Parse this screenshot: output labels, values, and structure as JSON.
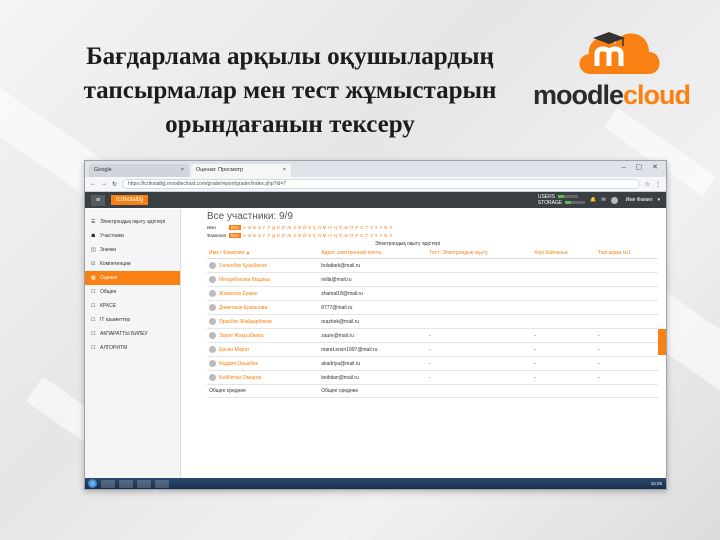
{
  "slide": {
    "title_lines": [
      "Бағдарлама арқылы оқушылардың",
      "тапсырмалар мен тест жұмыстарын",
      "орындағанын тексеру"
    ],
    "logo": {
      "part1": "moodle",
      "part2": "cloud"
    }
  },
  "colors": {
    "accent": "#f98012",
    "navbar": "#3a3f44"
  },
  "browser": {
    "tabs": [
      {
        "label": "Google",
        "close": "×"
      },
      {
        "label": "Оценки: Просмотр",
        "close": "×"
      }
    ],
    "window_controls": "– ▢ ✕",
    "url": "https://tcrtkotalbjj.moodlecloud.com/grade/report/grader/index.php?id=7"
  },
  "moodle": {
    "brand": "tcrtkotalbjj",
    "menu_icon": "≡",
    "users_label": "USERS",
    "storage_label": "STORAGE",
    "user_name": "Имя Фамил",
    "drawer": [
      {
        "icon": "☰",
        "label": "Электрондық оқыту әдістері",
        "active": false
      },
      {
        "icon": "☗",
        "label": "Участники",
        "active": false
      },
      {
        "icon": "◫",
        "label": "Значки",
        "active": false
      },
      {
        "icon": "☑",
        "label": "Компетенции",
        "active": false
      },
      {
        "icon": "▦",
        "label": "Оценки",
        "active": true
      },
      {
        "icon": "☐",
        "label": "Общее",
        "active": false
      },
      {
        "icon": "☐",
        "label": "КРКСЕ",
        "active": false
      },
      {
        "icon": "☐",
        "label": "ІТ кзыметтер",
        "active": false
      },
      {
        "icon": "☐",
        "label": "АКПАРАТТЫ БИЛЕУ",
        "active": false
      },
      {
        "icon": "☐",
        "label": "АЛГОРИТМ",
        "active": false
      }
    ],
    "page_title": "Все участники: 9/9",
    "first_label": "Имя",
    "last_label": "Фамилия",
    "all_label": "Все",
    "letters": [
      "А",
      "Ә",
      "Б",
      "В",
      "Г",
      "Ғ",
      "Д",
      "Е",
      "Ё",
      "Ж",
      "З",
      "И",
      "Й",
      "К",
      "Қ",
      "Л",
      "М",
      "Н",
      "Ң",
      "О",
      "Ө",
      "П",
      "Р",
      "С",
      "Т",
      "У",
      "Ұ",
      "Ү",
      "Ф",
      "Х"
    ],
    "group_label": "Электрондық оқыту әдістері",
    "headers": [
      "Имя / Фамилия ▲",
      "Адрес электронной почты",
      "Тест: Электрондық оқыту",
      "Кері байланыс",
      "Тапсырма №1"
    ],
    "rows": [
      {
        "name": "Халелбек Қуанбеков",
        "email": "bolatbek@mail.ru",
        "g1": "",
        "g2": "",
        "g3": ""
      },
      {
        "name": "Мелдебекова Мадина",
        "email": "milla@mail.ru",
        "g1": "",
        "g2": "",
        "g3": ""
      },
      {
        "name": "Жамалов Ержан",
        "email": "zhamal18@mail.ru",
        "g1": "",
        "g2": "",
        "g3": ""
      },
      {
        "name": "Дәметжан Ержанова",
        "email": "8777@mail.ru",
        "g1": "",
        "g2": "",
        "g3": ""
      },
      {
        "name": "Оразбек Жайдарбеков",
        "email": "orazbek@mail.ru",
        "g1": "",
        "g2": "",
        "g3": ""
      },
      {
        "name": "Зауре Жақсыбаева",
        "email": "zaure@mail.ru",
        "g1": "-",
        "g2": "-",
        "g3": "-"
      },
      {
        "name": "Ерсин Марат",
        "email": "marat.ersin1997@mail.ru",
        "g1": "-",
        "g2": "-",
        "g3": "-"
      },
      {
        "name": "Кадрия Орынбек",
        "email": "akadriya@mail.ru",
        "g1": "-",
        "g2": "-",
        "g3": "-"
      },
      {
        "name": "Бейбитан Омаров",
        "email": "beibitan@mail.ru",
        "g1": "-",
        "g2": "-",
        "g3": "-"
      }
    ],
    "footer": {
      "label1": "Общее среднее",
      "label2": "Общее среднее"
    }
  },
  "taskbar": {
    "clock": "15:25"
  }
}
